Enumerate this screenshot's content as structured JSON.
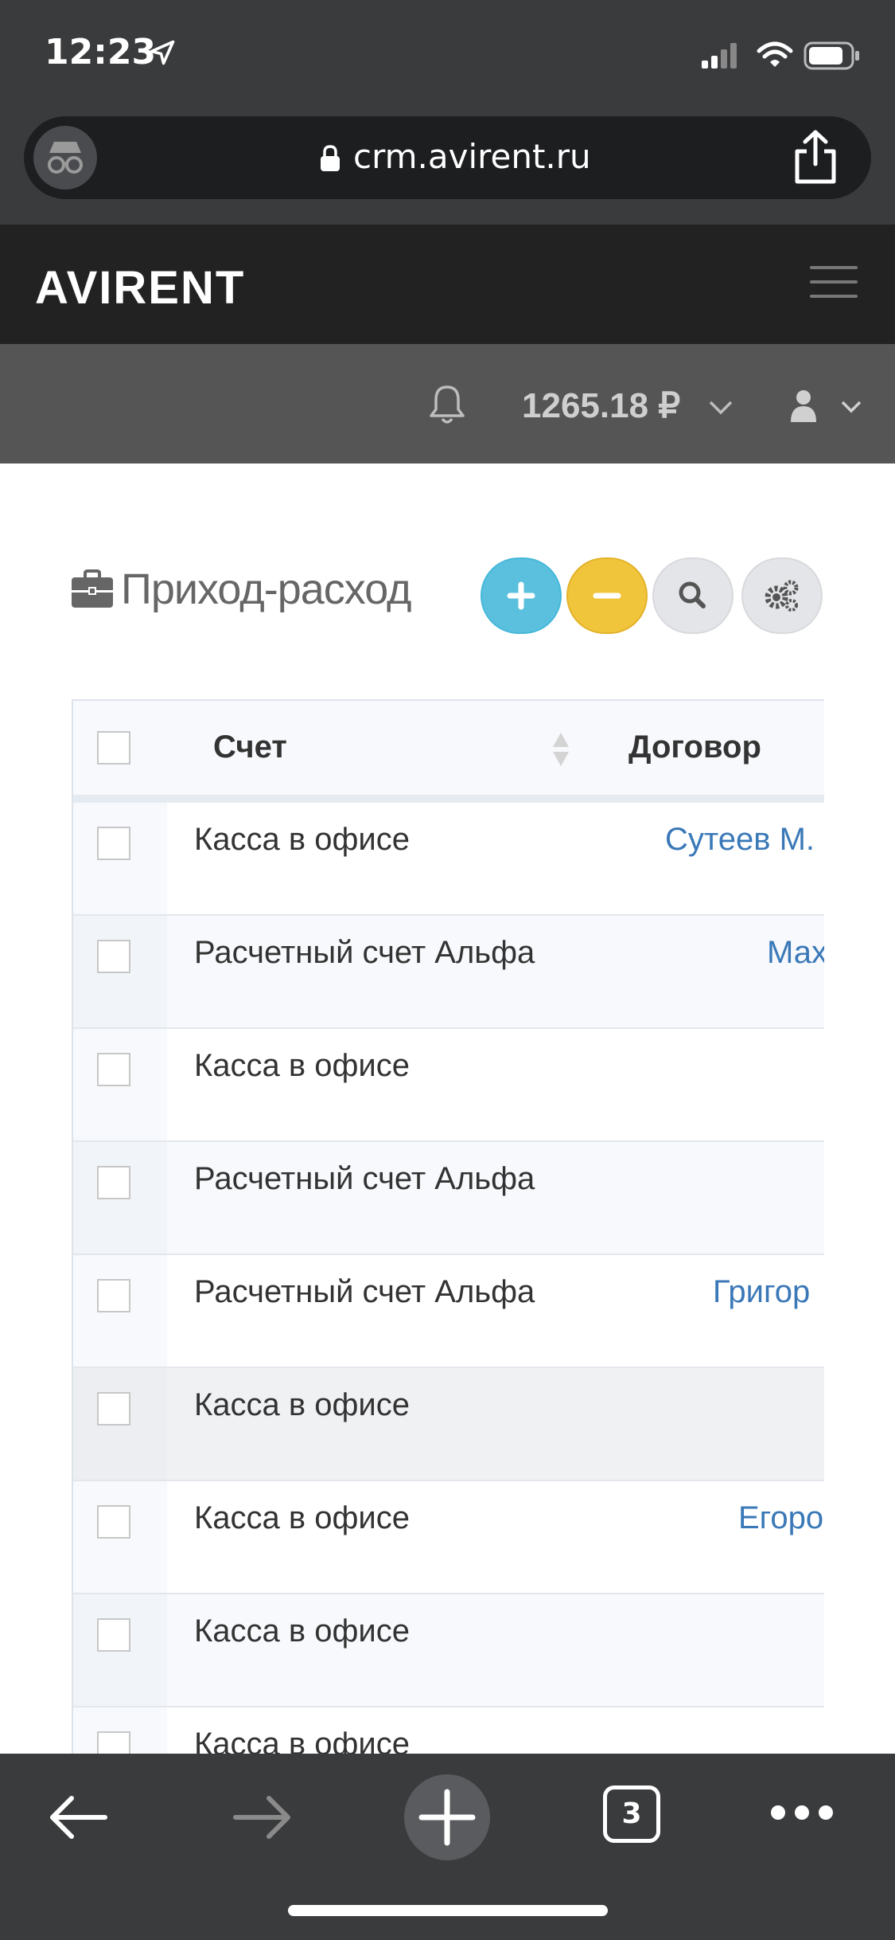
{
  "status": {
    "time": "12:23"
  },
  "browser": {
    "url": "crm.avirent.ru",
    "tab_count": "3"
  },
  "app": {
    "logo": "AVIRENT",
    "balance": "1265.18 ₽"
  },
  "page": {
    "title": "Приход-расход"
  },
  "table": {
    "headers": {
      "account": "Счет",
      "contract": "Договор"
    },
    "rows": [
      {
        "account": "Касса в офисе",
        "contract": "Сутеев М."
      },
      {
        "account": "Расчетный счет Альфа",
        "contract": "Мах"
      },
      {
        "account": "Касса в офисе",
        "contract": ""
      },
      {
        "account": "Расчетный счет Альфа",
        "contract": ""
      },
      {
        "account": "Расчетный счет Альфа",
        "contract": "Григор"
      },
      {
        "account": "Касса в офисе",
        "contract": ""
      },
      {
        "account": "Касса в офисе",
        "contract": "Егоро"
      },
      {
        "account": "Касса в офисе",
        "contract": ""
      },
      {
        "account": "Касса в офисе",
        "contract": ""
      }
    ]
  },
  "colors": {
    "add_button": "#5bc0de",
    "minus_button": "#f0c53c",
    "link": "#3a78b8",
    "header_bg": "#222222",
    "subbar_bg": "#555555"
  }
}
